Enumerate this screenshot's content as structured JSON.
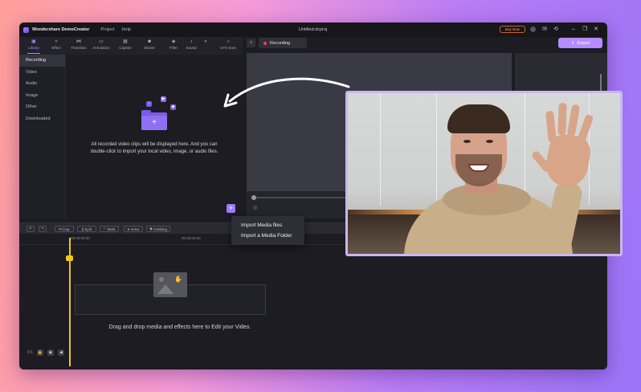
{
  "titlebar": {
    "app_name": "Wondershare DemoCreator",
    "menu_project": "Project",
    "menu_help": "Help",
    "filename": "Untitled.dcproj",
    "buy_now": "Buy Now"
  },
  "tools": [
    {
      "label": "Library",
      "icon": "library-icon"
    },
    {
      "label": "Effect",
      "icon": "effect-icon"
    },
    {
      "label": "Transition",
      "icon": "transition-icon"
    },
    {
      "label": "Annotation",
      "icon": "annotation-icon"
    },
    {
      "label": "Caption",
      "icon": "caption-icon"
    },
    {
      "label": "Sticker",
      "icon": "sticker-icon"
    },
    {
      "label": "Filter",
      "icon": "filter-icon"
    },
    {
      "label": "Sound",
      "icon": "sound-icon"
    },
    {
      "label": "STK store",
      "icon": "store-icon"
    }
  ],
  "sidebar": {
    "items": [
      "Recording",
      "Video",
      "Audio",
      "Image",
      "Other",
      "Downloaded"
    ]
  },
  "library": {
    "empty_text": "All recorded video clips will be displayed here. And you can double-click to import your local video, image, or audio files."
  },
  "player": {
    "recording_label": "Recording",
    "export_label": "Export"
  },
  "timeline": {
    "toolbar": [
      "Crop",
      "Split",
      "Mark",
      "Voice",
      "Dubbing"
    ],
    "ticks": [
      "00:00:00:00",
      "00:00:00:00"
    ],
    "drop_text": "Drag and drop media and effects here to Edit your Video.",
    "zoom_label": "0:1"
  },
  "popup": {
    "items": [
      "Import Media files",
      "Import a Media Folder"
    ]
  },
  "colors": {
    "accent": "#a98bff",
    "export_bg": "#b48cff",
    "playhead": "#f5c518",
    "record_dot": "#ff3b4d"
  }
}
